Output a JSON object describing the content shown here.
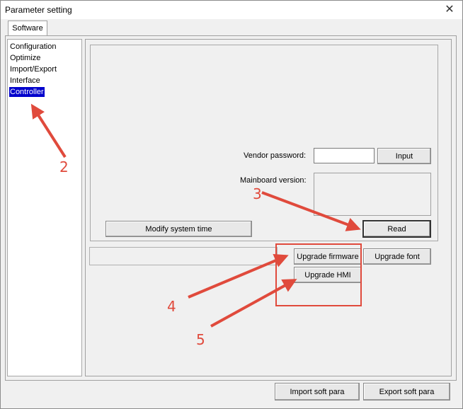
{
  "window": {
    "title": "Parameter setting",
    "close_glyph": "✕"
  },
  "tabs": [
    {
      "label": "Software"
    }
  ],
  "sidebar": {
    "items": [
      {
        "label": "Configuration"
      },
      {
        "label": "Optimize"
      },
      {
        "label": "Import/Export"
      },
      {
        "label": "Interface"
      },
      {
        "label": "Controller",
        "selected": true
      }
    ]
  },
  "controller": {
    "vendor_password_label": "Vendor password:",
    "vendor_password_value": "",
    "input_button": "Input",
    "mainboard_version_label": "Mainboard version:",
    "mainboard_version_value": "",
    "modify_time_button": "Modify system time",
    "read_button": "Read",
    "upgrade_firmware_button": "Upgrade firmware",
    "upgrade_font_button": "Upgrade font",
    "upgrade_hmi_button": "Upgrade HMI"
  },
  "footer": {
    "import_button": "Import soft para",
    "export_button": "Export soft para"
  },
  "annotations": {
    "labels": [
      "2",
      "3",
      "4",
      "5"
    ],
    "color": "#e04a3c"
  }
}
